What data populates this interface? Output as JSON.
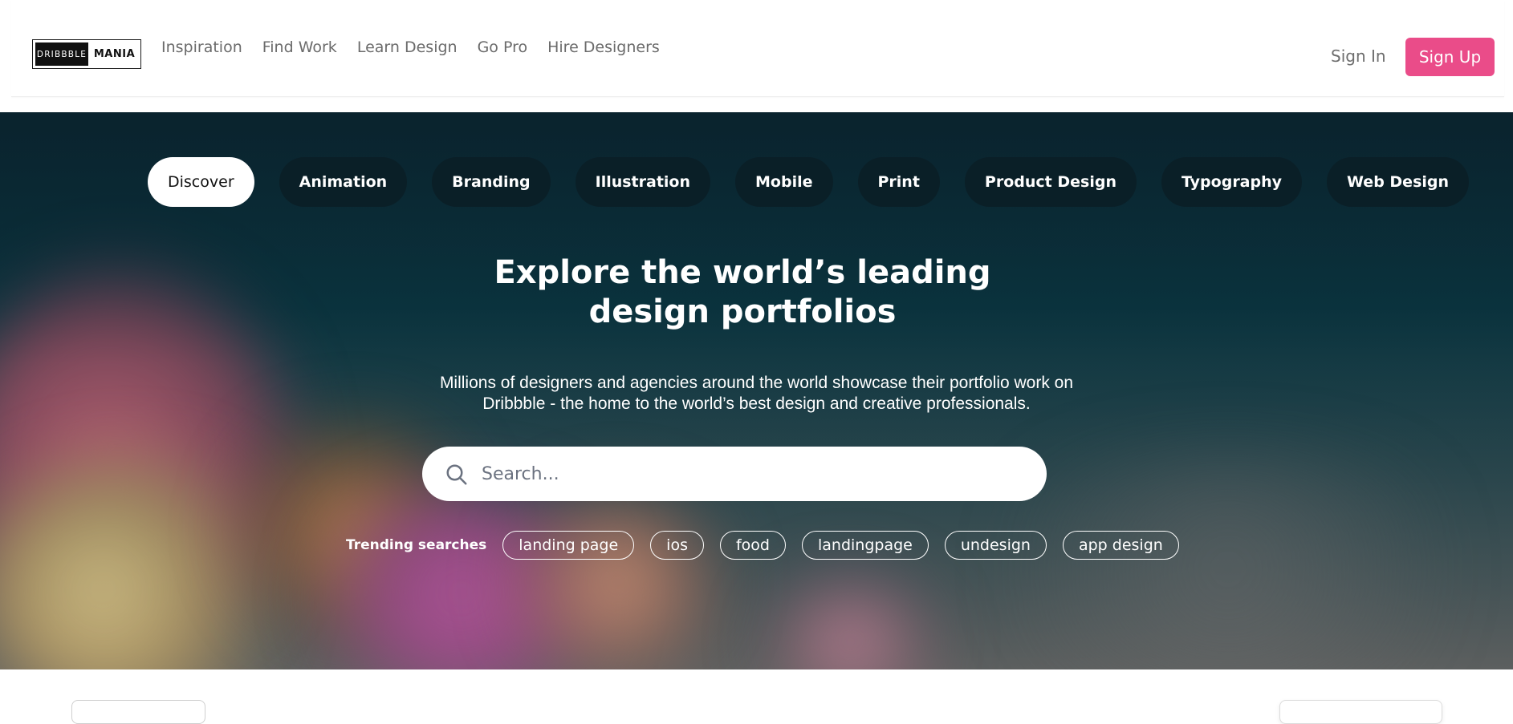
{
  "logo": {
    "left_text": "DRIBBBLE",
    "right_text": "MANIA"
  },
  "nav": {
    "items": [
      {
        "label": "Inspiration"
      },
      {
        "label": "Find Work"
      },
      {
        "label": "Learn Design"
      },
      {
        "label": "Go Pro"
      },
      {
        "label": "Hire Designers"
      }
    ]
  },
  "auth": {
    "signin": "Sign In",
    "signup": "Sign Up",
    "signup_color": "#ea4c89"
  },
  "categories": [
    {
      "label": "Discover",
      "active": true
    },
    {
      "label": "Animation"
    },
    {
      "label": "Branding"
    },
    {
      "label": "Illustration"
    },
    {
      "label": "Mobile"
    },
    {
      "label": "Print"
    },
    {
      "label": "Product Design"
    },
    {
      "label": "Typography"
    },
    {
      "label": "Web Design"
    }
  ],
  "hero": {
    "headline_line1": "Explore the world’s leading",
    "headline_line2": "design portfolios",
    "sub_line1": "Millions of designers and agencies around the world showcase their portfolio work on",
    "sub_line2": "Dribbble - the home to the world’s best design and creative professionals."
  },
  "search": {
    "placeholder": "Search...",
    "value": "",
    "icon": "search-icon"
  },
  "trending": {
    "label": "Trending searches",
    "items": [
      "landing page",
      "ios",
      "food",
      "landingpage",
      "undesign",
      "app design"
    ]
  }
}
